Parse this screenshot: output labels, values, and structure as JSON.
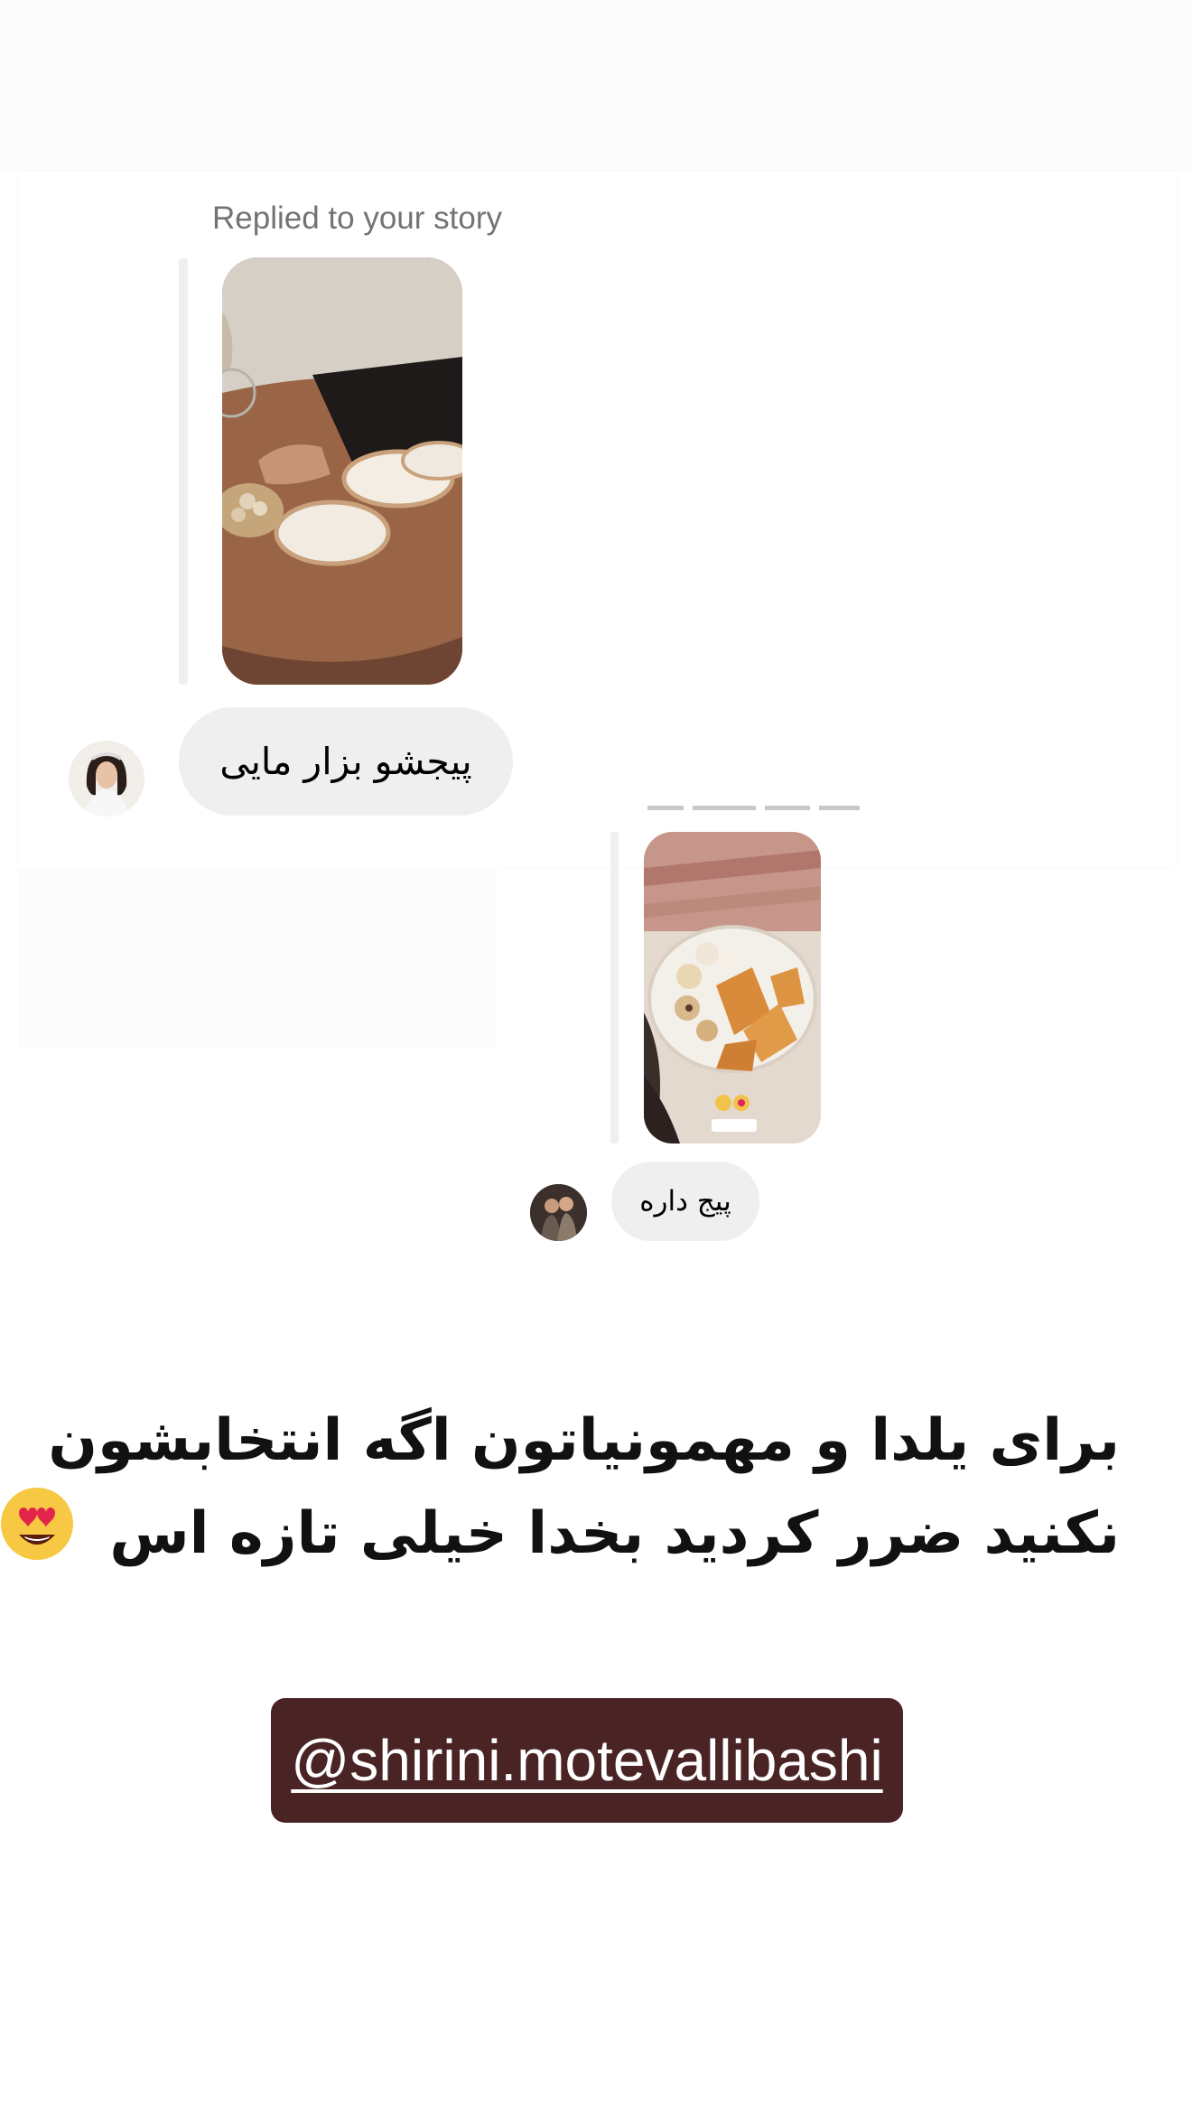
{
  "thread": {
    "reply_label": "Replied to your story",
    "messages": [
      {
        "text": "پیجشو بزار مایی"
      },
      {
        "text": "پیج داره"
      }
    ]
  },
  "caption": {
    "line1": "برای یلدا و مهمونیاتون اگه انتخابشون",
    "line2": "نکنید ضرر کردید بخدا خیلی تازه اس"
  },
  "mention": {
    "handle": "@shirini.motevallibashi"
  },
  "colors": {
    "mention_bg": "#4a2425",
    "bubble_bg": "#efefef",
    "label_gray": "#737373"
  },
  "icons": {
    "heart_eyes": "heart-eyes-emoji"
  }
}
